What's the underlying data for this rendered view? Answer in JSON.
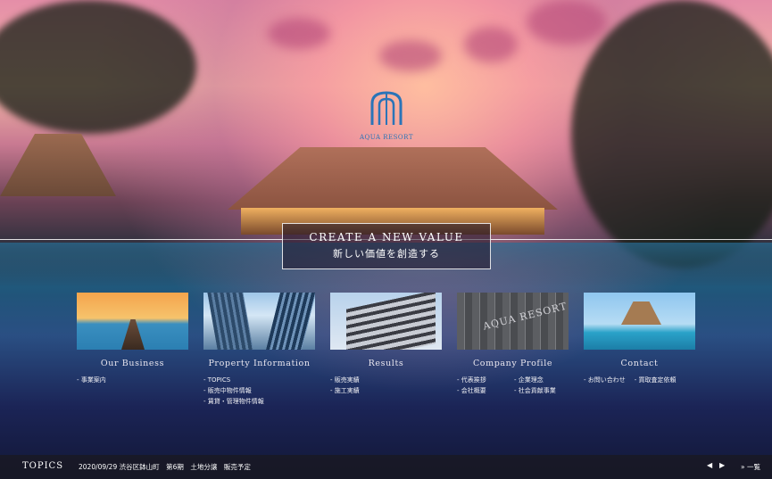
{
  "brand": {
    "logo_text": "AQUA RESORT"
  },
  "hero": {
    "title_en": "CREATE A NEW VALUE",
    "title_ja": "新しい価値を創造する"
  },
  "sections": [
    {
      "title": "Our Business",
      "image": "pier-sunset-photo",
      "links": [
        [
          "- 事業案内"
        ]
      ]
    },
    {
      "title": "Property Information",
      "image": "skyscrapers-photo",
      "links": [
        [
          "- TOPICS"
        ],
        [
          "- 販売中物件情報"
        ],
        [
          "- 賃貸・管理物件情報"
        ]
      ]
    },
    {
      "title": "Results",
      "image": "apartment-building-photo",
      "links": [
        [
          "- 販売実績"
        ],
        [
          "- 施工実績"
        ]
      ]
    },
    {
      "title": "Company Profile",
      "image": "company-sign-wall-photo",
      "image_text": "AQUA RESORT",
      "links": [
        [
          "- 代表挨拶",
          "- 企業理念"
        ],
        [
          "- 会社概要",
          "- 社会貢献事業"
        ]
      ]
    },
    {
      "title": "Contact",
      "image": "beach-pavilion-photo",
      "links": [
        [
          "- お問い合わせ",
          "- 買取査定依頼"
        ]
      ]
    }
  ],
  "topics_bar": {
    "label": "TOPICS",
    "news": "2020/09/29 渋谷区鉢山町　第6期　土地分譲　販売予定",
    "prev": "◀",
    "next": "▶",
    "view_all": "» 一覧"
  }
}
